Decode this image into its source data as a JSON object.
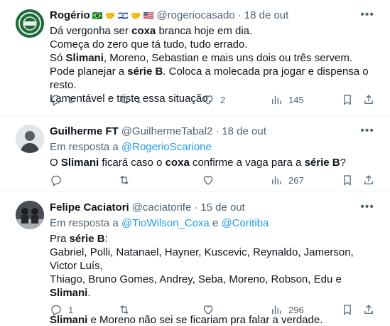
{
  "tweets": [
    {
      "name": "Rogério",
      "emojis": [
        "🇧🇷",
        "🤝",
        "🇮🇱",
        "🤝",
        "🇺🇸"
      ],
      "handle": "@rogeriocasado",
      "dot": "·",
      "date": "18 de out",
      "lines": [
        [
          {
            "t": "Dá vergonha ser "
          },
          {
            "t": "coxa",
            "b": true
          },
          {
            "t": " branca hoje em dia."
          }
        ],
        [
          {
            "t": "Começa do zero que tá tudo, tudo errado."
          }
        ],
        [
          {
            "t": "Só "
          },
          {
            "t": "Slimani",
            "b": true
          },
          {
            "t": ", Moreno, Sebastian e mais uns dois ou três servem."
          }
        ],
        [
          {
            "t": "Pode planejar a "
          },
          {
            "t": "série B",
            "b": true
          },
          {
            "t": ". Coloca a molecada pra jogar e dispensa o resto."
          }
        ],
        [
          {
            "t": "Lamentável e triste essa situação."
          }
        ]
      ],
      "replies": "1",
      "retweets": "1",
      "likes": "2",
      "views": "145"
    },
    {
      "name": "Guilherme FT",
      "handle": "@GuilhermeTabal2",
      "dot": "·",
      "date": "18 de out",
      "reply_prefix": "Em resposta a",
      "reply_to": "@RogerioScarione",
      "lines": [
        [
          {
            "t": "O "
          },
          {
            "t": "Slimani",
            "b": true
          },
          {
            "t": " ficará caso o "
          },
          {
            "t": "coxa",
            "b": true
          },
          {
            "t": " confirme a vaga para a "
          },
          {
            "t": "série B",
            "b": true
          },
          {
            "t": "?"
          }
        ]
      ],
      "replies": "",
      "retweets": "",
      "likes": "",
      "views": "267"
    },
    {
      "name": "Felipe Caciatori",
      "handle": "@caciatorife",
      "dot": "·",
      "date": "15 de out",
      "reply_prefix": "Em resposta a",
      "reply_to": "@TioWilson_Coxa",
      "reply_and": "e",
      "reply_to2": "@Coritiba",
      "lines": [
        [
          {
            "t": "Pra "
          },
          {
            "t": "série B",
            "b": true
          },
          {
            "t": ":"
          }
        ],
        [
          {
            "t": "Gabriel, Polli, Natanael, Hayner, Kuscevic, Reynaldo, Jamerson, Victor Luís,"
          }
        ],
        [
          {
            "t": "Thiago, Bruno Gomes, Andrey, Seba, Moreno, Robson, Edu e "
          },
          {
            "t": "Slimani",
            "b": true
          },
          {
            "t": "."
          }
        ],
        [
          {
            "t": " "
          }
        ],
        [
          {
            "t": "Slimani",
            "b": true
          },
          {
            "t": " e Moreno não sei se ficariam pra falar a verdade."
          }
        ]
      ],
      "replies": "1",
      "retweets": "",
      "likes": "",
      "views": "296"
    }
  ],
  "icons": {
    "more": "more-horizontal-icon",
    "reply": "reply-bubble-icon",
    "retweet": "retweet-icon",
    "like": "heart-icon",
    "views": "views-chart-icon",
    "bookmark": "bookmark-icon",
    "share": "share-icon"
  },
  "colors": {
    "link": "#1d9bf0",
    "muted": "#536471",
    "text": "#0f1419"
  }
}
